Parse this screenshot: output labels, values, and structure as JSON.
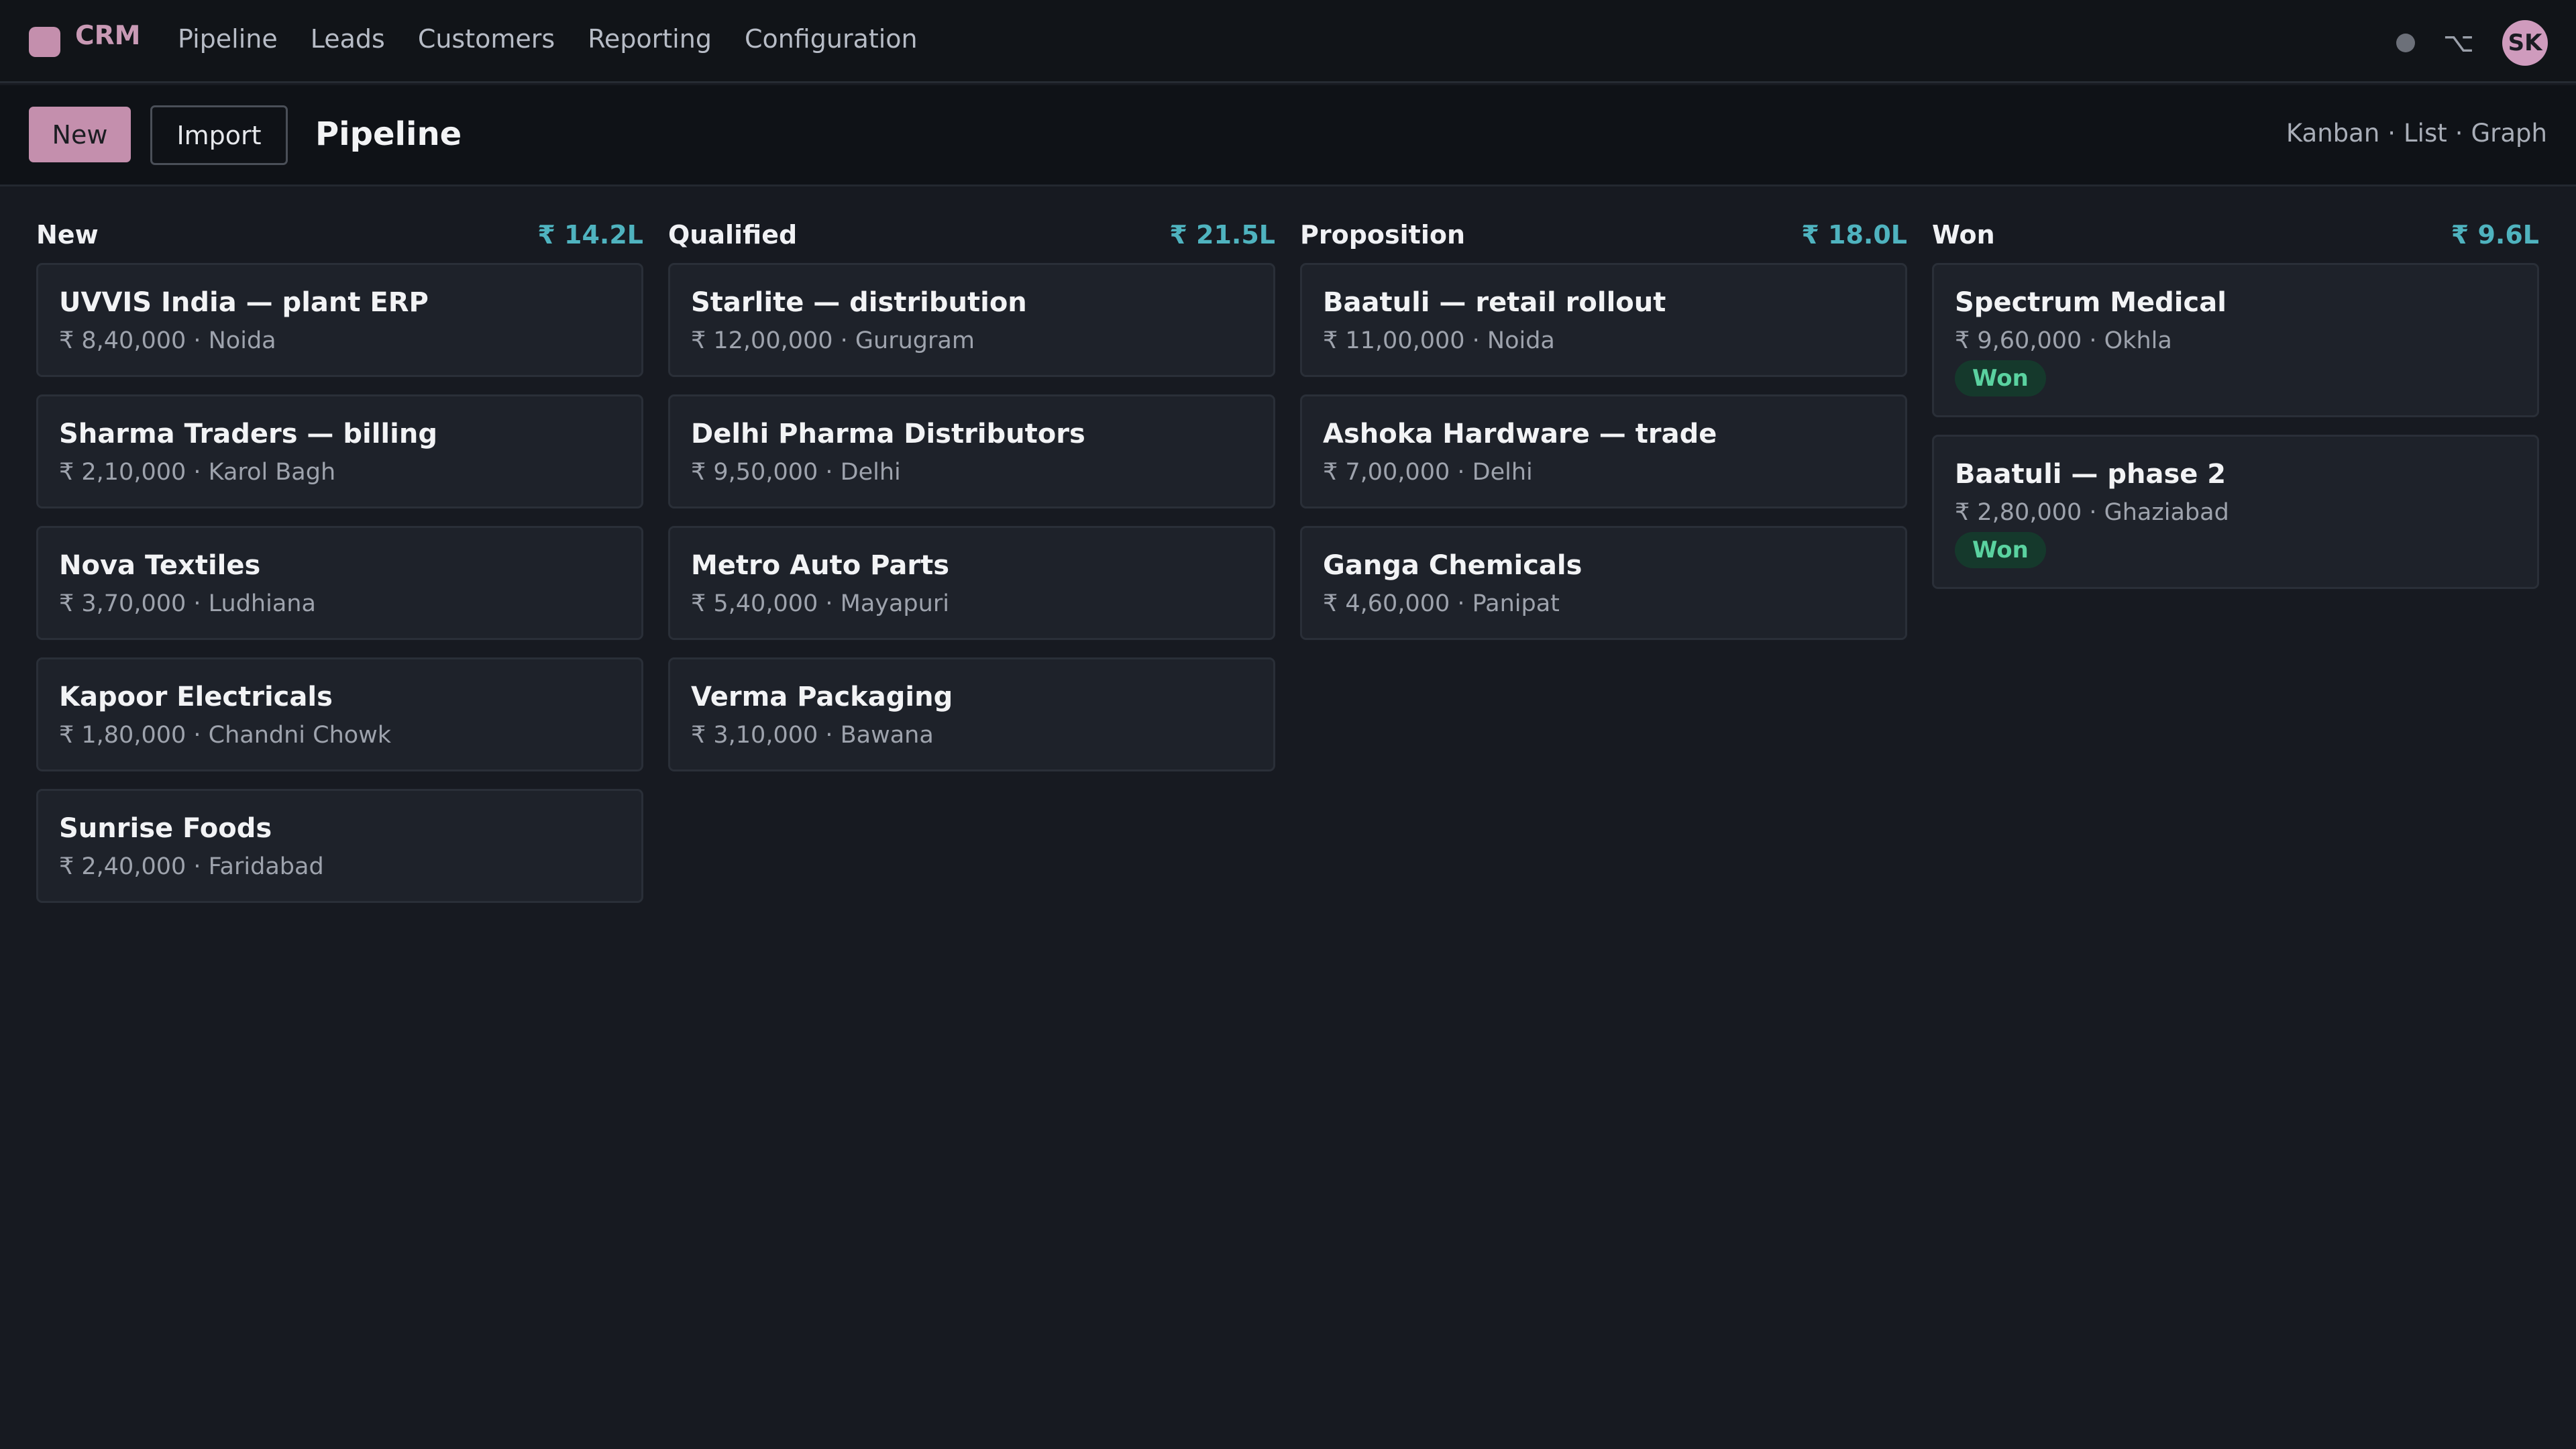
{
  "app": {
    "name": "CRM"
  },
  "nav": {
    "items": [
      {
        "label": "Pipeline"
      },
      {
        "label": "Leads"
      },
      {
        "label": "Customers"
      },
      {
        "label": "Reporting"
      },
      {
        "label": "Configuration"
      }
    ],
    "option_glyph": "⌥",
    "avatar_initials": "SK"
  },
  "toolbar": {
    "new_label": "New",
    "import_label": "Import",
    "title": "Pipeline",
    "views": [
      "Kanban",
      "List",
      "Graph"
    ],
    "view_separator": "·"
  },
  "colors": {
    "accent": "#c48fad",
    "total": "#4fb3bf",
    "won_badge_bg": "#15392c",
    "won_badge_text": "#5ad2a0"
  },
  "columns": [
    {
      "title": "New",
      "total": "₹ 14.2L",
      "cards": [
        {
          "title": "UVVIS India — plant ERP",
          "meta": "₹ 8,40,000 · Noida"
        },
        {
          "title": "Sharma Traders — billing",
          "meta": "₹ 2,10,000 · Karol Bagh"
        },
        {
          "title": "Nova Textiles",
          "meta": "₹ 3,70,000 · Ludhiana"
        },
        {
          "title": "Kapoor Electricals",
          "meta": "₹ 1,80,000 · Chandni Chowk"
        },
        {
          "title": "Sunrise Foods",
          "meta": "₹ 2,40,000 · Faridabad"
        }
      ]
    },
    {
      "title": "Qualified",
      "total": "₹ 21.5L",
      "cards": [
        {
          "title": "Starlite — distribution",
          "meta": "₹ 12,00,000 · Gurugram"
        },
        {
          "title": "Delhi Pharma Distributors",
          "meta": "₹ 9,50,000 · Delhi"
        },
        {
          "title": "Metro Auto Parts",
          "meta": "₹ 5,40,000 · Mayapuri"
        },
        {
          "title": "Verma Packaging",
          "meta": "₹ 3,10,000 · Bawana"
        }
      ]
    },
    {
      "title": "Proposition",
      "total": "₹ 18.0L",
      "cards": [
        {
          "title": "Baatuli — retail rollout",
          "meta": "₹ 11,00,000 · Noida"
        },
        {
          "title": "Ashoka Hardware — trade",
          "meta": "₹ 7,00,000 · Delhi"
        },
        {
          "title": "Ganga Chemicals",
          "meta": "₹ 4,60,000 · Panipat"
        }
      ]
    },
    {
      "title": "Won",
      "total": "₹ 9.6L",
      "cards": [
        {
          "title": "Spectrum Medical",
          "meta": "₹ 9,60,000 · Okhla",
          "badge": "Won"
        },
        {
          "title": "Baatuli — phase 2",
          "meta": "₹ 2,80,000 · Ghaziabad",
          "badge": "Won"
        }
      ]
    }
  ]
}
